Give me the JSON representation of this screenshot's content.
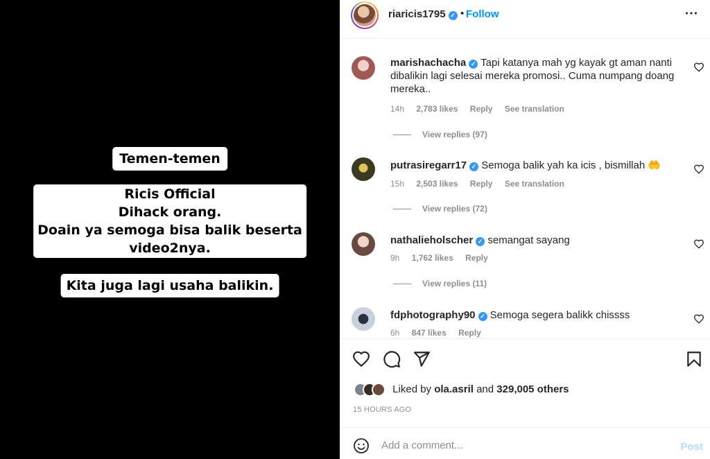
{
  "media": {
    "box1": "Temen-temen",
    "box2_lines": [
      "Ricis Official",
      "Dihack orang.",
      "Doain ya semoga bisa balik beserta",
      "video2nya."
    ],
    "box3": "Kita juga lagi usaha balikin."
  },
  "header": {
    "username": "riaricis1795",
    "separator": "•",
    "follow_label": "Follow",
    "more_icon": "more-horizontal-icon"
  },
  "comments": [
    {
      "username": "marishachacha",
      "text": "Tapi katanya mah yg kayak gt aman nanti dibalikin lagi selesai mereka promosi.. Cuma numpang doang mereka..",
      "time": "14h",
      "likes": "2,783 likes",
      "reply": "Reply",
      "translate": "See translation",
      "view_replies": "View replies (97)",
      "avatar_color": "#c98a86"
    },
    {
      "username": "putrasiregarr17",
      "text": "Semoga balik yah ka icis , bismillah 🤲",
      "time": "15h",
      "likes": "2,503 likes",
      "reply": "Reply",
      "translate": "See translation",
      "view_replies": "View replies (72)",
      "avatar_color": "#6b6a3a"
    },
    {
      "username": "nathalieholscher",
      "text": "semangat sayang",
      "time": "9h",
      "likes": "1,762 likes",
      "reply": "Reply",
      "view_replies": "View replies (11)",
      "avatar_color": "#b8968b"
    },
    {
      "username": "fdphotography90",
      "text": "Semoga segera balikk chissss",
      "time": "6h",
      "likes": "847 likes",
      "reply": "Reply",
      "avatar_color": "#5a6a80"
    }
  ],
  "actions": {
    "liked_prefix": "Liked by",
    "liked_user": "ola.asril",
    "liked_and": "and",
    "liked_others": "329,005 others",
    "timestamp": "15 HOURS AGO"
  },
  "add_comment": {
    "placeholder": "Add a comment...",
    "post_label": "Post"
  },
  "colors": {
    "accent": "#0095f6",
    "verified": "#3897f0",
    "muted": "#8e8e8e"
  }
}
